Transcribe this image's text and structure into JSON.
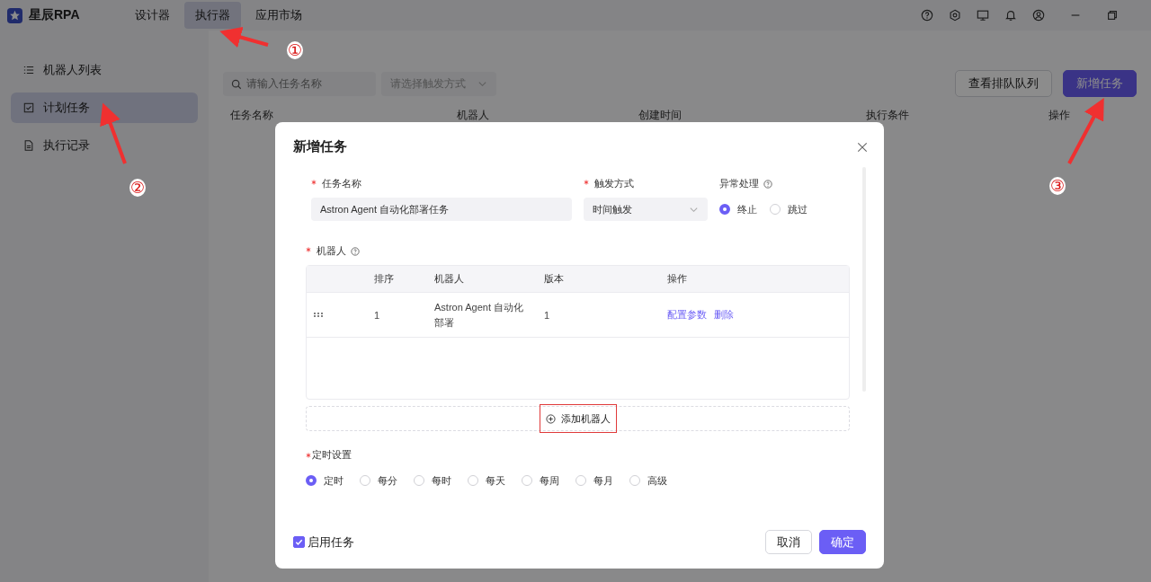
{
  "app": {
    "name": "星辰RPA",
    "nav": [
      {
        "label": "设计器",
        "selected": false
      },
      {
        "label": "执行器",
        "selected": true
      },
      {
        "label": "应用市场",
        "selected": false
      }
    ]
  },
  "sidebar": [
    {
      "label": "机器人列表",
      "kind": "list",
      "selected": false
    },
    {
      "label": "计划任务",
      "kind": "plan",
      "selected": true
    },
    {
      "label": "执行记录",
      "kind": "record",
      "selected": false
    }
  ],
  "toolbar": {
    "search_placeholder": "请输入任务名称",
    "trigger_placeholder": "请选择触发方式",
    "buttons": [
      {
        "label": "查看排队队列",
        "kind": "default"
      },
      {
        "label": "新增任务",
        "kind": "primary"
      }
    ]
  },
  "table": {
    "columns": [
      "任务名称",
      "机器人",
      "创建时间",
      "执行条件",
      "操作"
    ]
  },
  "dialog": {
    "title": "新增任务",
    "task_name": {
      "label": "任务名称",
      "required": true,
      "value": "Astron Agent 自动化部署任务"
    },
    "trigger": {
      "label": "触发方式",
      "required": true,
      "value": "时间触发"
    },
    "error_handling": {
      "label": "异常处理",
      "options": [
        {
          "label": "终止",
          "selected": true
        },
        {
          "label": "跳过",
          "selected": false
        }
      ]
    },
    "robots": {
      "label": "机器人",
      "required": true,
      "columns": [
        "排序",
        "机器人",
        "版本",
        "操作"
      ],
      "rows": [
        {
          "order": "1",
          "robot": "Astron Agent 自动化部署",
          "version": "1",
          "actions": [
            "配置参数",
            "删除"
          ]
        }
      ],
      "add_button": {
        "label": "添加机器人",
        "highlighted": true
      }
    },
    "schedule": {
      "label": "定时设置",
      "required": true,
      "options": [
        {
          "label": "定时",
          "selected": true
        },
        {
          "label": "每分",
          "selected": false
        },
        {
          "label": "每时",
          "selected": false
        },
        {
          "label": "每天",
          "selected": false
        },
        {
          "label": "每周",
          "selected": false
        },
        {
          "label": "每月",
          "selected": false
        },
        {
          "label": "高级",
          "selected": false
        }
      ]
    },
    "enable": {
      "label": "启用任务",
      "checked": true
    },
    "buttons": [
      {
        "label": "取消",
        "kind": "default"
      },
      {
        "label": "确定",
        "kind": "primary"
      }
    ]
  },
  "annotations": [
    {
      "label": "①"
    },
    {
      "label": "②"
    },
    {
      "label": "③"
    }
  ]
}
